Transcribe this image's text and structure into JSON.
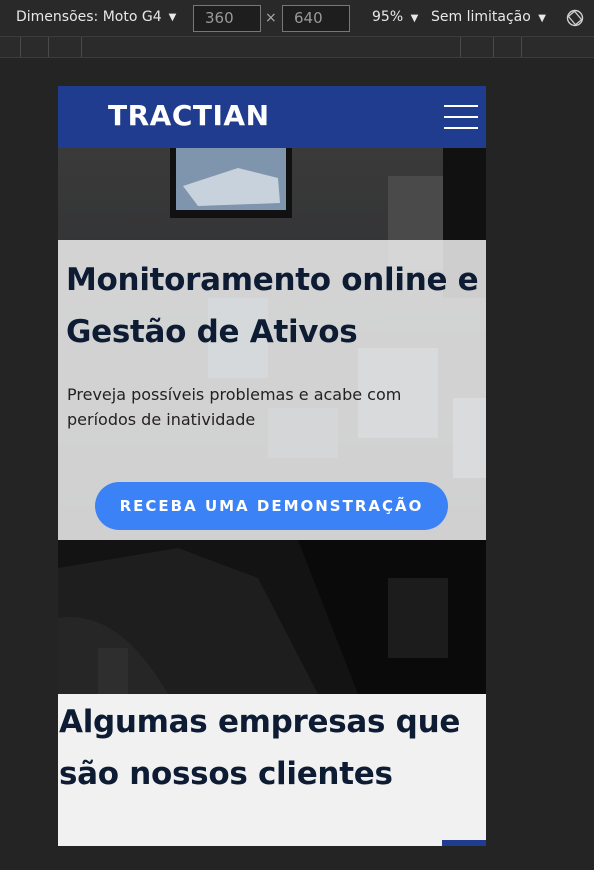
{
  "devtools": {
    "device_label": "Dimensões: Moto G4",
    "width": "360",
    "height": "640",
    "times": "×",
    "zoom": "95%",
    "throttle": "Sem limitação",
    "caret": "▼"
  },
  "site": {
    "logo": "TRACTIAN",
    "hero_title": "Monitoramento online e Gestão de Ativos",
    "hero_subtitle": "Preveja possíveis problemas e acabe com períodos de inatividade",
    "cta_label": "RECEBA UMA DEMONSTRAÇÃO",
    "clients_title": "Algumas empresas que são nossos clientes"
  },
  "colors": {
    "header": "#1f3c8f",
    "cta": "#3b82f6",
    "title_text": "#0d1b33"
  },
  "icons": [
    "chevron-down-icon",
    "rotate-icon",
    "hamburger-menu-icon"
  ]
}
